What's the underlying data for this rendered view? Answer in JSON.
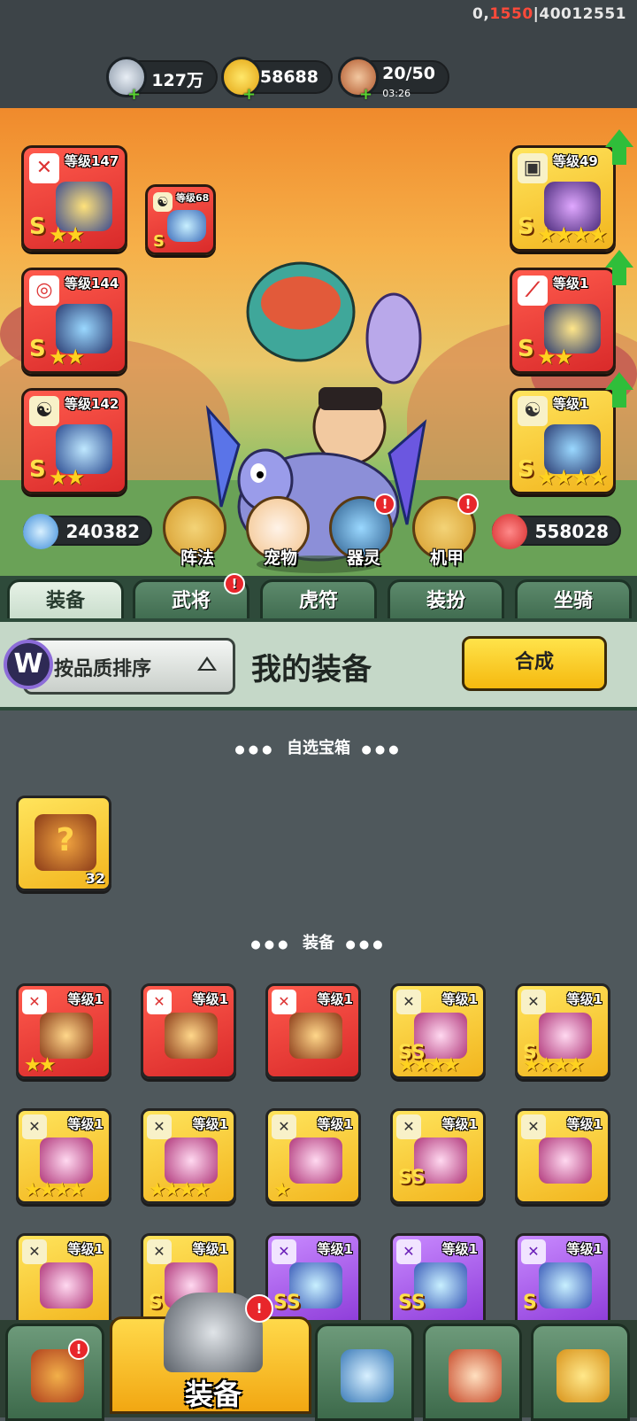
{
  "header": {
    "uid_prefix": "0,",
    "uid_red": "1550",
    "uid_suffix": "|40012551",
    "resources": [
      {
        "name": "silver",
        "value": "127万"
      },
      {
        "name": "gold-ingot",
        "value": "58688"
      },
      {
        "name": "stamina",
        "value": "20/50",
        "timer": "03:26"
      }
    ]
  },
  "equipped_left": [
    {
      "level": "等级147",
      "grade": "S",
      "stars": "★★"
    },
    {
      "level": "等级144",
      "grade": "S",
      "stars": "★★"
    },
    {
      "level": "等级142",
      "grade": "S",
      "stars": "★★"
    }
  ],
  "equipped_small": {
    "level": "等级68",
    "grade": "S"
  },
  "equipped_right": [
    {
      "level": "等级49",
      "grade": "S",
      "stars": "★★★★"
    },
    {
      "level": "等级1",
      "grade": "S",
      "stars": "★★"
    },
    {
      "level": "等级1",
      "grade": "S",
      "stars": "★★★★"
    }
  ],
  "stats": {
    "attack": "240382",
    "health": "558028"
  },
  "features": [
    {
      "label": "阵法",
      "alert": ""
    },
    {
      "label": "宠物",
      "alert": ""
    },
    {
      "label": "器灵",
      "alert": "!"
    },
    {
      "label": "机甲",
      "alert": "!"
    }
  ],
  "tabs": [
    {
      "label": "装备",
      "alert": ""
    },
    {
      "label": "武将",
      "alert": "!"
    },
    {
      "label": "虎符",
      "alert": ""
    },
    {
      "label": "装扮",
      "alert": ""
    },
    {
      "label": "坐骑",
      "alert": ""
    }
  ],
  "panel": {
    "sort_label": "按品质排序",
    "title": "我的装备",
    "synth_label": "合成",
    "logo": "W"
  },
  "sections": {
    "chest_title": "自选宝箱",
    "equip_title": "装备",
    "chest_count": "32",
    "chest_glyph": "?"
  },
  "inventory": [
    {
      "rarity": "red",
      "level": "等级1",
      "grade": "",
      "stars": "★★"
    },
    {
      "rarity": "red",
      "level": "等级1",
      "grade": "",
      "stars": ""
    },
    {
      "rarity": "red",
      "level": "等级1",
      "grade": "",
      "stars": ""
    },
    {
      "rarity": "gold",
      "level": "等级1",
      "grade": "SS",
      "stars": "★★★★"
    },
    {
      "rarity": "gold",
      "level": "等级1",
      "grade": "S",
      "stars": "★★★★"
    },
    {
      "rarity": "gold",
      "level": "等级1",
      "grade": "",
      "stars": "★★★★"
    },
    {
      "rarity": "gold",
      "level": "等级1",
      "grade": "",
      "stars": "★★★★"
    },
    {
      "rarity": "gold",
      "level": "等级1",
      "grade": "",
      "stars": "★"
    },
    {
      "rarity": "gold",
      "level": "等级1",
      "grade": "SS",
      "stars": ""
    },
    {
      "rarity": "gold",
      "level": "等级1",
      "grade": "",
      "stars": ""
    },
    {
      "rarity": "gold",
      "level": "等级1",
      "grade": "",
      "stars": ""
    },
    {
      "rarity": "gold",
      "level": "等级1",
      "grade": "S",
      "stars": ""
    },
    {
      "rarity": "purple",
      "level": "等级1",
      "grade": "SS",
      "stars": ""
    },
    {
      "rarity": "purple",
      "level": "等级1",
      "grade": "SS",
      "stars": ""
    },
    {
      "rarity": "purple",
      "level": "等级1",
      "grade": "S",
      "stars": ""
    }
  ],
  "bottom_nav": {
    "active_label": "装备",
    "alert": "!"
  },
  "colors": {
    "red_slot": "#d92a2a",
    "gold_slot": "#f2b51e",
    "purple_slot": "#8c3ad8",
    "accent_green": "#2fbe3a"
  }
}
